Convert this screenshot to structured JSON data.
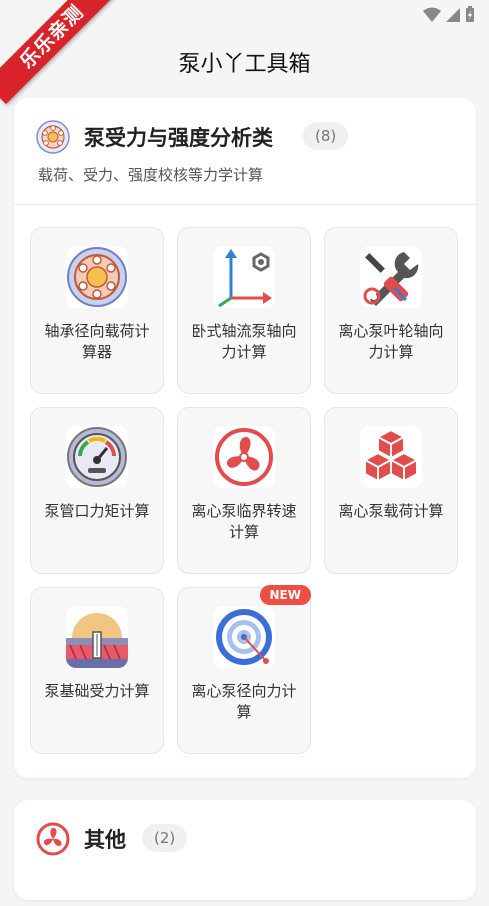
{
  "app": {
    "title": "泵小丫工具箱",
    "ribbon": "乐乐亲测"
  },
  "categories": [
    {
      "title": "泵受力与强度分析类",
      "count": "(8)",
      "description": "载荷、受力、强度校核等力学计算",
      "tools": [
        {
          "label": "轴承径向载荷计算器",
          "icon": "bearing-icon"
        },
        {
          "label": "卧式轴流泵轴向力计算",
          "icon": "axes-icon"
        },
        {
          "label": "离心泵叶轮轴向力计算",
          "icon": "wrench-icon"
        },
        {
          "label": "泵管口力矩计算",
          "icon": "gauge-icon"
        },
        {
          "label": "离心泵临界转速计算",
          "icon": "fan-icon"
        },
        {
          "label": "离心泵载荷计算",
          "icon": "cubes-icon"
        },
        {
          "label": "泵基础受力计算",
          "icon": "foundation-icon"
        },
        {
          "label": "离心泵径向力计算",
          "icon": "target-icon",
          "badge": "NEW"
        }
      ]
    },
    {
      "title": "其他",
      "count": "(2)"
    }
  ],
  "colors": {
    "ribbon": "#d8232a",
    "badge": "#ef4e45",
    "accent": "#e74c3c"
  }
}
